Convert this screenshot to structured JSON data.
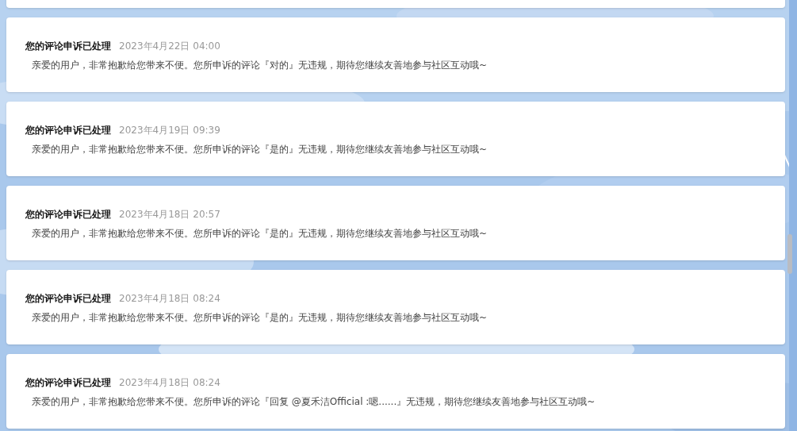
{
  "notifications": [
    {
      "title": "您的评论申诉已处理",
      "time": "2023年4月22日 04:00",
      "body": "亲爱的用户，非常抱歉给您带来不便。您所申诉的评论『对的』无违规，期待您继续友善地参与社区互动哦~"
    },
    {
      "title": "您的评论申诉已处理",
      "time": "2023年4月19日 09:39",
      "body": "亲爱的用户，非常抱歉给您带来不便。您所申诉的评论『是的』无违规，期待您继续友善地参与社区互动哦~"
    },
    {
      "title": "您的评论申诉已处理",
      "time": "2023年4月18日 20:57",
      "body": "亲爱的用户，非常抱歉给您带来不便。您所申诉的评论『是的』无违规，期待您继续友善地参与社区互动哦~"
    },
    {
      "title": "您的评论申诉已处理",
      "time": "2023年4月18日 08:24",
      "body": "亲爱的用户，非常抱歉给您带来不便。您所申诉的评论『是的』无违规，期待您继续友善地参与社区互动哦~"
    },
    {
      "title": "您的评论申诉已处理",
      "time": "2023年4月18日 08:24",
      "body": "亲爱的用户，非常抱歉给您带来不便。您所申诉的评论『回复 @夏禾洁Official :嗯......』无违规，期待您继续友善地参与社区互动哦~"
    }
  ]
}
